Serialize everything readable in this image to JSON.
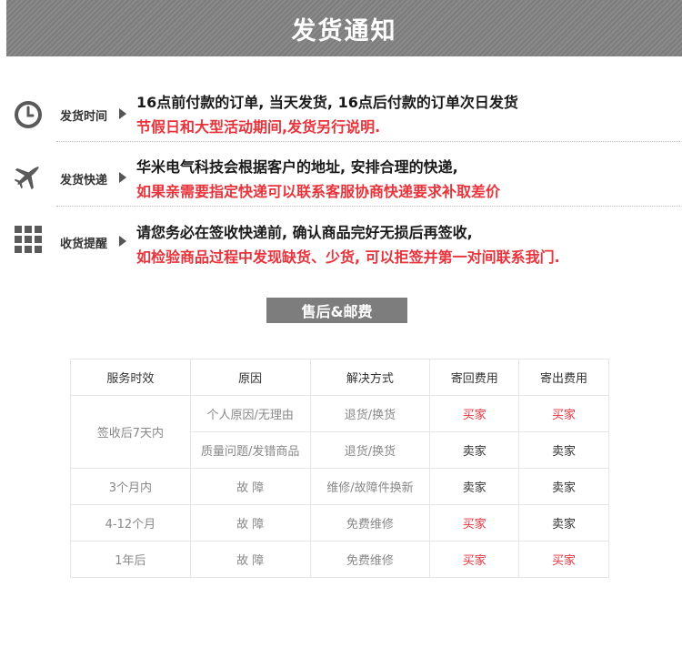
{
  "banner": {
    "title": "发货通知"
  },
  "rows": [
    {
      "icon": "clock-icon",
      "label": "发货时间",
      "line1": "16点前付款的订单, 当天发货, 16点后付款的订单次日发货",
      "line2": "节假日和大型活动期间,发货另行说明."
    },
    {
      "icon": "airplane-icon",
      "label": "发货快递",
      "line1": "华米电气科技会根据客户的地址, 安排合理的快递,",
      "line2": "如果亲需要指定快递可以联系客服协商快递要求补取差价"
    },
    {
      "icon": "grid-icon",
      "label": "收货提醒",
      "line1": "请您务必在签收快递前, 确认商品完好无损后再签收,",
      "line2": "如检验商品过程中发现缺货、少货, 可以拒签并第一对间联系我门."
    }
  ],
  "after_sales": {
    "title": "售后&邮费",
    "headers": [
      "服务时效",
      "原因",
      "解决方式",
      "寄回费用",
      "寄出费用"
    ],
    "rows": [
      {
        "period": "签收后7天内",
        "reason": "个人原因/无理由",
        "solution": "退货/换货",
        "return_fee": "买家",
        "send_fee": "买家"
      },
      {
        "reason": "质量问题/发错商品",
        "solution": "退货/换货",
        "return_fee": "卖家",
        "send_fee": "卖家"
      },
      {
        "period": "3个月内",
        "reason": "故 障",
        "solution": "维修/故障件换新",
        "return_fee": "卖家",
        "send_fee": "卖家"
      },
      {
        "period": "4-12个月",
        "reason": "故 障",
        "solution": "免费维修",
        "return_fee": "买家",
        "send_fee": "卖家"
      },
      {
        "period": "1年后",
        "reason": "故 障",
        "solution": "免费维修",
        "return_fee": "买家",
        "send_fee": "买家"
      }
    ]
  },
  "colors": {
    "accent_red": "#e8333b",
    "banner_gray": "#808080"
  }
}
